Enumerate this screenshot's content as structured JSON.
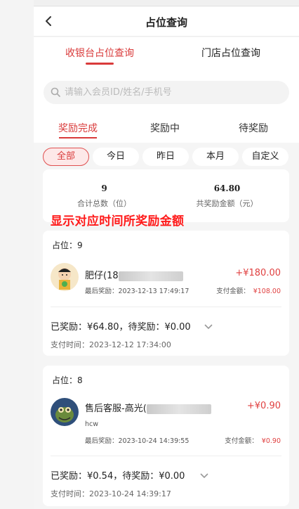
{
  "header": {
    "title": "占位查询"
  },
  "main_tabs": [
    {
      "label": "收银台占位查询",
      "active": true
    },
    {
      "label": "门店占位查询",
      "active": false
    }
  ],
  "search": {
    "placeholder": "请输入会员ID/姓名/手机号"
  },
  "sub_tabs": [
    {
      "label": "奖励完成",
      "active": true
    },
    {
      "label": "奖励中",
      "active": false
    },
    {
      "label": "待奖励",
      "active": false
    }
  ],
  "filter_chips": [
    {
      "label": "全部",
      "active": true
    },
    {
      "label": "今日",
      "active": false
    },
    {
      "label": "昨日",
      "active": false
    },
    {
      "label": "本月",
      "active": false
    },
    {
      "label": "自定义",
      "active": false
    }
  ],
  "summary": {
    "total_count": "9",
    "total_count_label": "合计总数（位）",
    "total_reward": "64.80",
    "total_reward_label": "共奖励金额（元）"
  },
  "annotation": "显示对应时间所奖励金额",
  "records": [
    {
      "seat": "占位：9",
      "name": "肥仔(18",
      "name_suffix": "",
      "amount": "+¥180.00",
      "last_reward": "最后奖励：2023-12-13 17:49:17",
      "pay_label": "支付金额：",
      "pay_amount": "¥108.00",
      "reward_line": "已奖励：¥64.80，待奖励：¥0.00",
      "pay_time": "支付时间：2023-12-12 17:34:00"
    },
    {
      "seat": "占位：8",
      "name": "售后客服-高光(",
      "name_suffix": "",
      "nickname": "hcw",
      "amount": "+¥0.90",
      "last_reward": "最后奖励：2023-10-24 14:39:55",
      "pay_label": "支付金额：",
      "pay_amount": "¥0.90",
      "reward_line": "已奖励：¥0.54，待奖励：¥0.00",
      "pay_time": "支付时间：2023-10-24 14:39:17"
    }
  ],
  "colors": {
    "accent": "#d93a3a",
    "annotation": "#ff1a1a"
  }
}
